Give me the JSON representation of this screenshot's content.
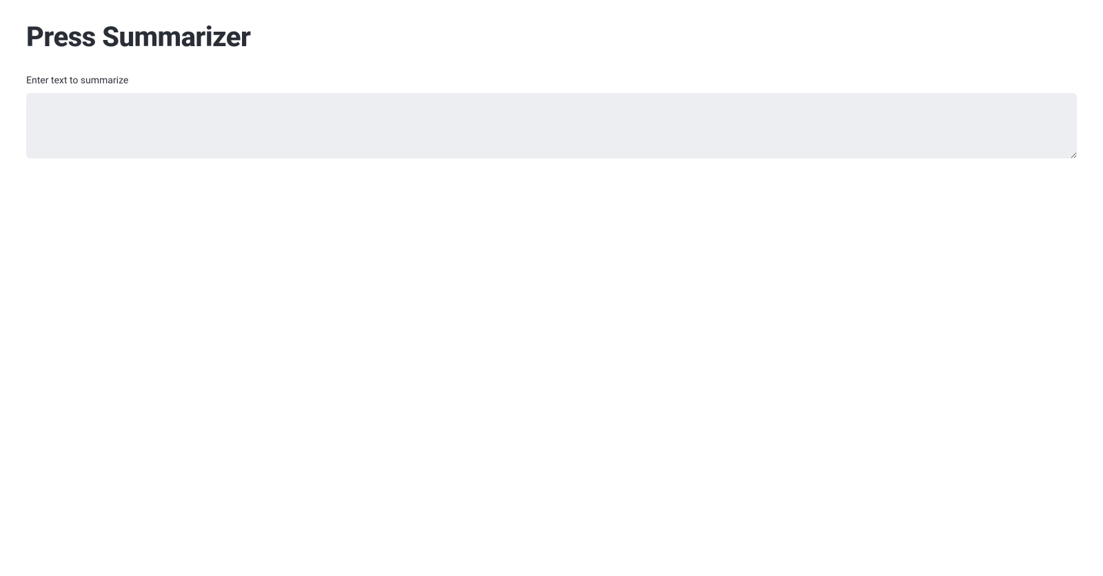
{
  "header": {
    "title": "Press Summarizer"
  },
  "form": {
    "input_label": "Enter text to summarize",
    "input_value": ""
  }
}
